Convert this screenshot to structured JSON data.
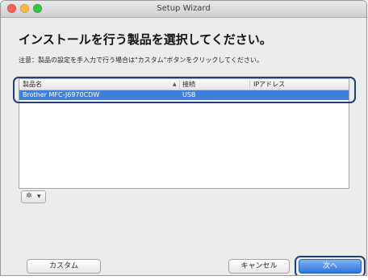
{
  "window": {
    "title": "Setup Wizard"
  },
  "heading": "インストールを行う製品を選択してください。",
  "note": "注意：製品の設定を手入力で行う場合は\"カスタム\"ボタンをクリックしてください。",
  "table": {
    "columns": [
      "製品名",
      "接続",
      "IPアドレス"
    ],
    "rows": [
      {
        "name": "Brother MFC-J6970CDW",
        "connection": "USB",
        "ip": ""
      }
    ]
  },
  "icons": {
    "gear": "gear-icon",
    "dropdown": "chevron-down-icon"
  },
  "buttons": {
    "custom": "カスタム",
    "cancel": "キャンセル",
    "next": "次へ"
  },
  "colors": {
    "selection": "#3f7fd9",
    "highlight_outline": "#1f3f7a",
    "primary_button": "#2f75df"
  }
}
